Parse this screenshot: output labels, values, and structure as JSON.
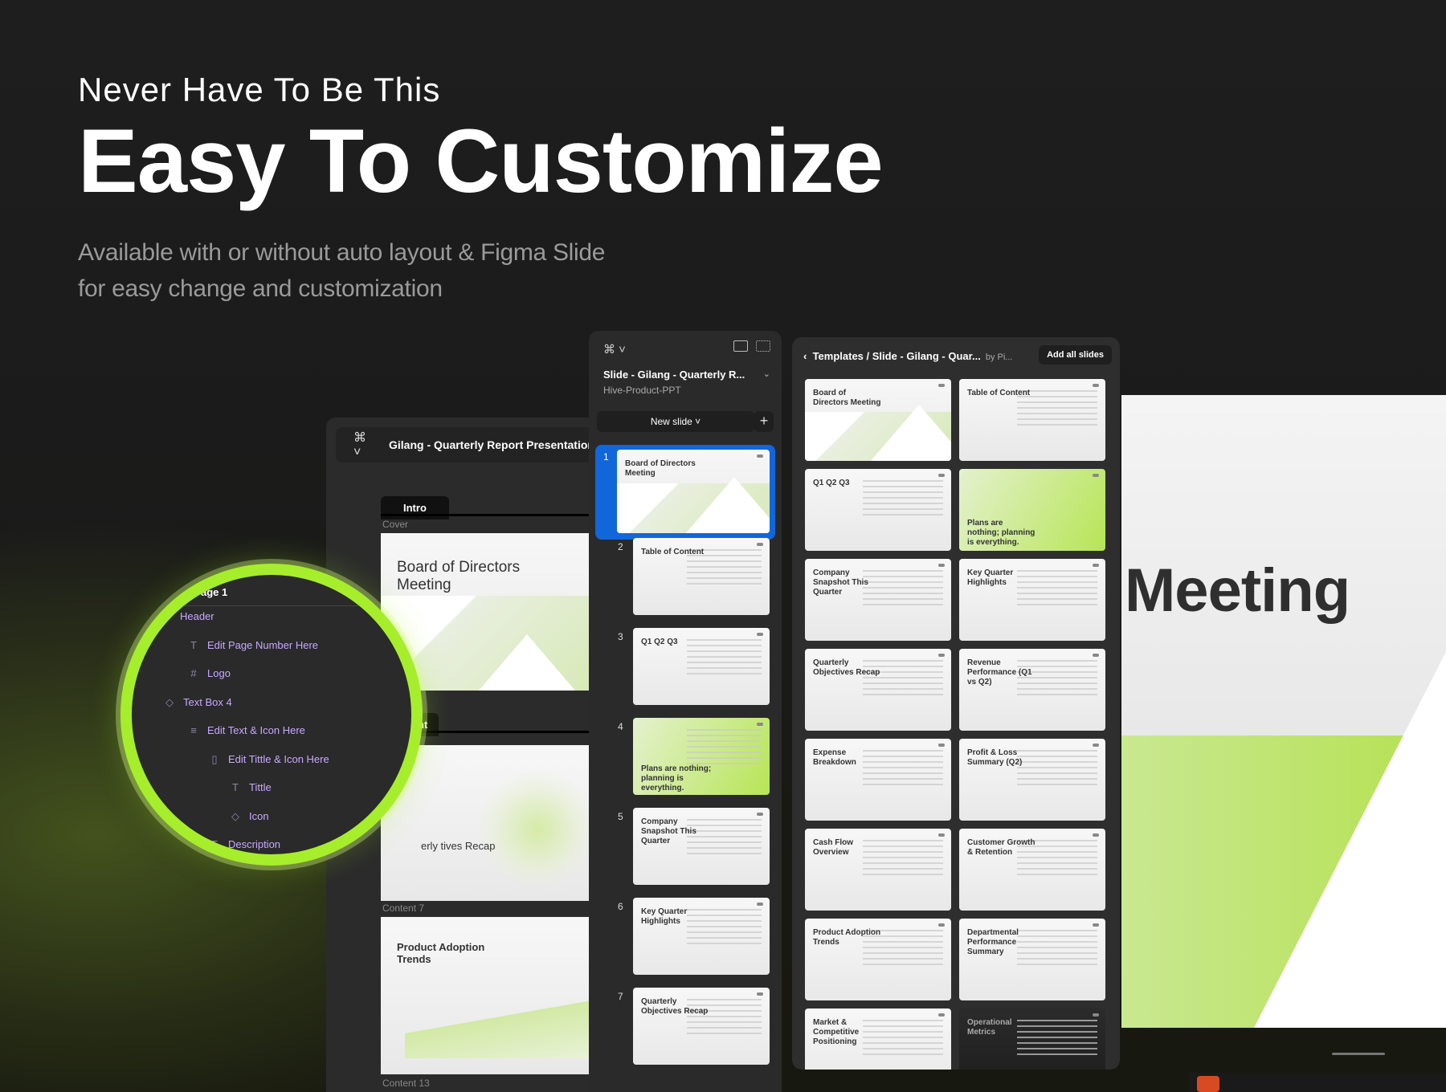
{
  "hero": {
    "kicker": "Never Have To Be This",
    "title": "Easy To Customize",
    "desc_line1": "Available with or without auto layout  & Figma Slide",
    "desc_line2": "for easy change and customization"
  },
  "editor": {
    "file_name": "Gilang - Quarterly Report Presentation T",
    "section_intro": "Intro",
    "label_cover": "Cover",
    "cover_title": "Board of Directors Meeting",
    "section_tab_partial": "nt",
    "content_partial_title": "erly tives Recap",
    "label_content7": "Content 7",
    "product_title": "Product Adoption Trends",
    "label_content13": "Content 13"
  },
  "slides_panel": {
    "file_name": "Slide - Gilang - Quarterly R...",
    "project": "Hive-Product-PPT",
    "new_slide": "New slide",
    "items": [
      {
        "num": "1",
        "title": "Board of Directors Meeting",
        "style": "cover"
      },
      {
        "num": "2",
        "title": "Table of Content",
        "style": "plain"
      },
      {
        "num": "3",
        "title": "Q1 Q2 Q3",
        "style": "plain"
      },
      {
        "num": "4",
        "title": "Plans are nothing; planning is everything.",
        "style": "green"
      },
      {
        "num": "5",
        "title": "Company Snapshot This Quarter",
        "style": "plain"
      },
      {
        "num": "6",
        "title": "Key Quarter Highlights",
        "style": "plain"
      },
      {
        "num": "7",
        "title": "Quarterly Objectives Recap",
        "style": "plain"
      }
    ]
  },
  "gallery": {
    "path": "Templates / Slide - Gilang - Quar...",
    "by": "by Pi...",
    "add_all": "Add all slides",
    "items": [
      {
        "title": "Board of Directors Meeting",
        "style": "cover"
      },
      {
        "title": "Table of Content",
        "style": "plain"
      },
      {
        "title": "Q1 Q2 Q3",
        "style": "plain"
      },
      {
        "title": "Plans are nothing; planning is everything.",
        "style": "green"
      },
      {
        "title": "Company Snapshot This Quarter",
        "style": "plain"
      },
      {
        "title": "Key Quarter Highlights",
        "style": "plain"
      },
      {
        "title": "Quarterly Objectives Recap",
        "style": "plain"
      },
      {
        "title": "Revenue Performance (Q1 vs Q2)",
        "style": "plain"
      },
      {
        "title": "Expense Breakdown",
        "style": "plain"
      },
      {
        "title": "Profit & Loss Summary (Q2)",
        "style": "plain"
      },
      {
        "title": "Cash Flow Overview",
        "style": "plain"
      },
      {
        "title": "Customer Growth & Retention",
        "style": "plain"
      },
      {
        "title": "Product Adoption Trends",
        "style": "plain"
      },
      {
        "title": "Departmental Performance Summary",
        "style": "plain"
      },
      {
        "title": "Market & Competitive Positioning",
        "style": "plain"
      },
      {
        "title": "Operational Metrics",
        "style": "dark"
      }
    ]
  },
  "canvas": {
    "word": "Meeting"
  },
  "layers": {
    "page": "age 1",
    "items": [
      {
        "icon": "",
        "label": "Header"
      },
      {
        "icon": "T",
        "label": "Edit Page Number Here"
      },
      {
        "icon": "#",
        "label": "Logo"
      },
      {
        "icon": "◇",
        "label": "Text Box 4"
      },
      {
        "icon": "≡",
        "label": "Edit Text & Icon Here"
      },
      {
        "icon": "▯",
        "label": "Edit Tittle & Icon Here"
      },
      {
        "icon": "T",
        "label": "Tittle"
      },
      {
        "icon": "◇",
        "label": "Icon"
      },
      {
        "icon": "T",
        "label": "Description"
      }
    ]
  },
  "colors": {
    "accent": "#a6ee2b",
    "selection": "#1167d9",
    "layer_text": "#c7a9ff"
  }
}
